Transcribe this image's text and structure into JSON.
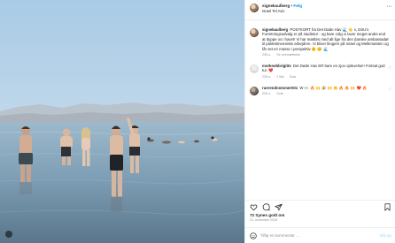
{
  "post": {
    "username": "signekaulberg",
    "separator": "•",
    "follow_label": "Følg",
    "location": "Israel Tel Aviv",
    "more_icon": "more-horizontal-icon",
    "photo_description": "group of people standing in the sea with mountains on the horizon"
  },
  "comments": [
    {
      "username": "signekaulberg",
      "text": "POSTKORT fra Det Døde Hav 🌊 👋 s, DSU's Forretningsudvalg er på studietur - og bare rolig vi laver meget andet end at dyppe os i havet! Vi har mødtes med alt lige fra den danske ambassadør til palæstinensiske arbejdere. Vi bliver klogere på Israel og Mellemøsten og får set en masse i perspektiv 🌞 😊 🌊",
      "age": "235 u.",
      "reply": "Se oversættelse",
      "likes": ""
    },
    {
      "username": "morkoebbrigitte",
      "text": "Det Døde Hav ER bare en sjov oplevelse!! Fortsat god tur. ❤️",
      "age": "235 u.",
      "likes": "1 like",
      "reply": "Svar"
    },
    {
      "username": "ruerendnstomer001",
      "text": "W 👀 🔥 🙌 🎉 🙌 👏 🔥 🔥 🙌 ❤️ 🔥",
      "age": "235 u.",
      "likes": "",
      "reply": "Svar"
    }
  ],
  "actions": {
    "like_icon": "heart-icon",
    "comment_icon": "comment-icon",
    "share_icon": "send-icon",
    "save_icon": "bookmark-icon"
  },
  "likes_text": "72 Synes godt om",
  "date_text": "21. november 2018",
  "add_comment": {
    "placeholder": "Tilføj en kommentar …",
    "post_label": "Slå op",
    "emoji_icon": "smiley-icon"
  },
  "colors": {
    "accent": "#0095f6",
    "text": "#262626",
    "muted": "#8e8e8e",
    "post_disabled": "#b2dffc"
  }
}
